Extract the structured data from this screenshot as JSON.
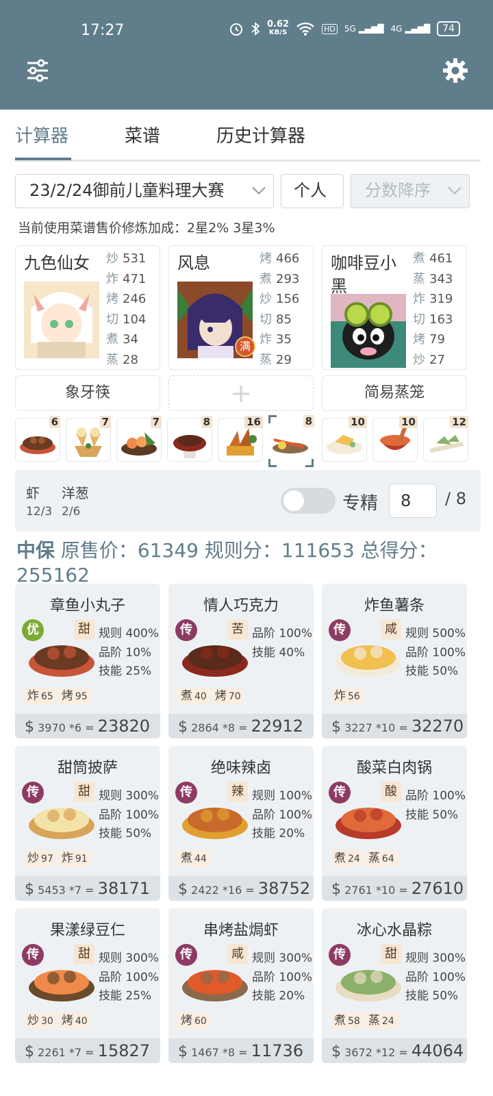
{
  "status": {
    "time": "17:27",
    "net_speed": "0.62",
    "net_unit": "KB/S",
    "hd": "HD",
    "sig1": "5G",
    "sig2": "4G",
    "battery": "74"
  },
  "tabs": [
    {
      "label": "计算器"
    },
    {
      "label": "菜谱"
    },
    {
      "label": "历史计算器"
    }
  ],
  "filters": {
    "contest": "23/2/24御前儿童料理大赛",
    "mode": "个人",
    "sort": "分数降序"
  },
  "bonus_note": "当前使用菜谱售价修炼加成：2星2% 3星3%",
  "chefs": [
    {
      "name": "九色仙女",
      "stats": [
        {
          "k": "炒",
          "v": "531"
        },
        {
          "k": "炸",
          "v": "471"
        },
        {
          "k": "烤",
          "v": "246"
        },
        {
          "k": "切",
          "v": "104"
        },
        {
          "k": "煮",
          "v": "34"
        },
        {
          "k": "蒸",
          "v": "28"
        }
      ]
    },
    {
      "name": "风息",
      "badge": "满",
      "stats": [
        {
          "k": "烤",
          "v": "466"
        },
        {
          "k": "煮",
          "v": "293"
        },
        {
          "k": "炒",
          "v": "156"
        },
        {
          "k": "切",
          "v": "85"
        },
        {
          "k": "炸",
          "v": "35"
        },
        {
          "k": "蒸",
          "v": "29"
        }
      ]
    },
    {
      "name": "咖啡豆小黑",
      "stats": [
        {
          "k": "煮",
          "v": "461"
        },
        {
          "k": "蒸",
          "v": "343"
        },
        {
          "k": "炸",
          "v": "319"
        },
        {
          "k": "切",
          "v": "163"
        },
        {
          "k": "烤",
          "v": "79"
        },
        {
          "k": "炒",
          "v": "27"
        }
      ]
    }
  ],
  "equips": [
    {
      "label": "象牙筷"
    },
    {
      "label": "+"
    },
    {
      "label": "简易蒸笼"
    }
  ],
  "dish_thumbs": [
    {
      "count": "6"
    },
    {
      "count": "7"
    },
    {
      "count": "7"
    },
    {
      "count": "8"
    },
    {
      "count": "16"
    },
    {
      "count": "8"
    },
    {
      "count": "10"
    },
    {
      "count": "10"
    },
    {
      "count": "12"
    }
  ],
  "ingredients": [
    {
      "name": "虾",
      "qty": "12/3"
    },
    {
      "name": "洋葱",
      "qty": "2/6"
    }
  ],
  "specialize": {
    "label": "专精",
    "value": "8",
    "total": "/ 8",
    "enabled": false
  },
  "summary": {
    "tag": "中保",
    "text": " 原售价：61349 规则分：111653 总得分：255162"
  },
  "dishes": [
    {
      "title": "章鱼小丸子",
      "rank": "优",
      "rank_type": "you",
      "flavor": "甜",
      "rules": [
        "规则 400%",
        "品阶 10%",
        "技能 25%"
      ],
      "skills": [
        {
          "k": "炸",
          "v": "65"
        },
        {
          "k": "烤",
          "v": "95"
        }
      ],
      "unit": "3970",
      "qty": "*6",
      "total": "23820"
    },
    {
      "title": "情人巧克力",
      "rank": "传",
      "rank_type": "chuan",
      "flavor": "苦",
      "rules": [
        "品阶 100%",
        "技能 40%"
      ],
      "skills": [
        {
          "k": "煮",
          "v": "40"
        },
        {
          "k": "烤",
          "v": "70"
        }
      ],
      "unit": "2864",
      "qty": "*8",
      "total": "22912"
    },
    {
      "title": "炸鱼薯条",
      "rank": "传",
      "rank_type": "chuan",
      "flavor": "咸",
      "rules": [
        "规则 500%",
        "品阶 100%",
        "技能 50%"
      ],
      "skills": [
        {
          "k": "炸",
          "v": "56"
        }
      ],
      "unit": "3227",
      "qty": "*10",
      "total": "32270"
    },
    {
      "title": "甜筒披萨",
      "rank": "传",
      "rank_type": "chuan",
      "flavor": "甜",
      "rules": [
        "规则 300%",
        "品阶 100%",
        "技能 50%"
      ],
      "skills": [
        {
          "k": "炒",
          "v": "97"
        },
        {
          "k": "炸",
          "v": "91"
        }
      ],
      "unit": "5453",
      "qty": "*7",
      "total": "38171"
    },
    {
      "title": "绝味辣卤",
      "rank": "传",
      "rank_type": "chuan",
      "flavor": "辣",
      "rules": [
        "规则 100%",
        "品阶 100%",
        "技能 20%"
      ],
      "skills": [
        {
          "k": "煮",
          "v": "44"
        }
      ],
      "unit": "2422",
      "qty": "*16",
      "total": "38752"
    },
    {
      "title": "酸菜白肉锅",
      "rank": "传",
      "rank_type": "chuan",
      "flavor": "酸",
      "rules": [
        "品阶 100%",
        "技能 50%"
      ],
      "skills": [
        {
          "k": "煮",
          "v": "24"
        },
        {
          "k": "蒸",
          "v": "64"
        }
      ],
      "unit": "2761",
      "qty": "*10",
      "total": "27610"
    },
    {
      "title": "果漾绿豆仁",
      "rank": "传",
      "rank_type": "chuan",
      "flavor": "甜",
      "rules": [
        "规则 300%",
        "品阶 100%",
        "技能 25%"
      ],
      "skills": [
        {
          "k": "炒",
          "v": "30"
        },
        {
          "k": "烤",
          "v": "40"
        }
      ],
      "unit": "2261",
      "qty": "*7",
      "total": "15827"
    },
    {
      "title": "串烤盐焗虾",
      "rank": "传",
      "rank_type": "chuan",
      "flavor": "咸",
      "rules": [
        "规则 300%",
        "品阶 100%",
        "技能 20%"
      ],
      "skills": [
        {
          "k": "烤",
          "v": "60"
        }
      ],
      "unit": "1467",
      "qty": "*8",
      "total": "11736"
    },
    {
      "title": "冰心水晶粽",
      "rank": "传",
      "rank_type": "chuan",
      "flavor": "甜",
      "rules": [
        "规则 300%",
        "品阶 100%",
        "技能 50%"
      ],
      "skills": [
        {
          "k": "煮",
          "v": "58"
        },
        {
          "k": "蒸",
          "v": "24"
        }
      ],
      "unit": "3672",
      "qty": "*12",
      "total": "44064"
    }
  ]
}
